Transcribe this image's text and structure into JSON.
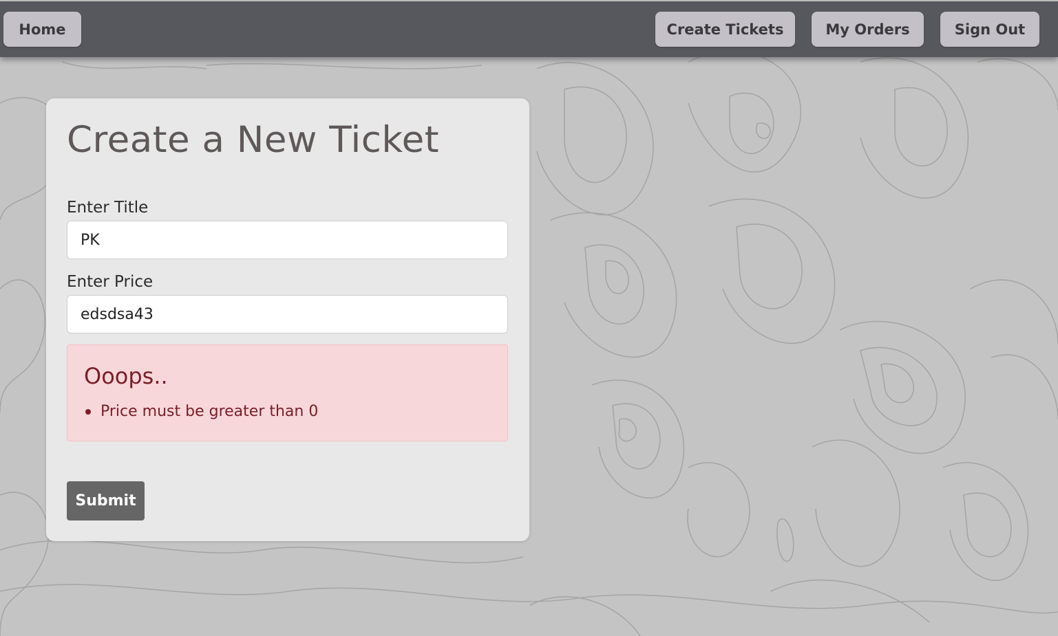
{
  "nav": {
    "home_label": "Home",
    "create_tickets_label": "Create Tickets",
    "my_orders_label": "My Orders",
    "sign_out_label": "Sign Out"
  },
  "form": {
    "heading": "Create a New Ticket",
    "title_label": "Enter Title",
    "title_value": "PK",
    "price_label": "Enter Price",
    "price_value": "edsdsa43",
    "submit_label": "Submit"
  },
  "error": {
    "heading": "Ooops..",
    "messages": [
      "Price must be greater than 0"
    ]
  },
  "colors": {
    "navbar": "#57585d",
    "nav_button": "#c4c0c7",
    "card": "#e8e8e8",
    "alert_bg": "#f7d7da",
    "alert_text": "#7a1f28",
    "submit_button": "#666666"
  }
}
